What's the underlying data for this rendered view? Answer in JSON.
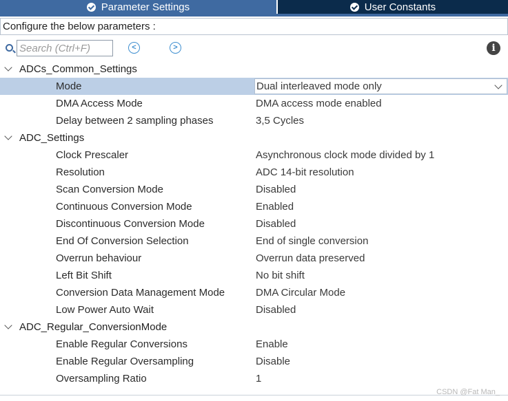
{
  "tabs": [
    {
      "label": "Parameter Settings",
      "active": true
    },
    {
      "label": "User Constants",
      "active": false
    }
  ],
  "configure_label": "Configure the below parameters :",
  "toolbar": {
    "search_placeholder": "Search (Ctrl+F)",
    "search_value": "",
    "prev_glyph": "<",
    "next_glyph": ">",
    "info_glyph": "i"
  },
  "groups": [
    {
      "name": "ADCs_Common_Settings",
      "params": [
        {
          "name": "Mode",
          "value": "Dual interleaved mode only"
        },
        {
          "name": "DMA Access Mode",
          "value": "DMA access mode enabled"
        },
        {
          "name": "Delay between 2 sampling phases",
          "value": "3,5 Cycles"
        }
      ]
    },
    {
      "name": "ADC_Settings",
      "params": [
        {
          "name": "Clock Prescaler",
          "value": "Asynchronous clock mode divided by 1"
        },
        {
          "name": "Resolution",
          "value": "ADC 14-bit resolution"
        },
        {
          "name": "Scan Conversion Mode",
          "value": "Disabled"
        },
        {
          "name": "Continuous Conversion Mode",
          "value": "Enabled"
        },
        {
          "name": "Discontinuous Conversion Mode",
          "value": "Disabled"
        },
        {
          "name": "End Of Conversion Selection",
          "value": "End of single conversion"
        },
        {
          "name": "Overrun behaviour",
          "value": "Overrun data preserved"
        },
        {
          "name": "Left Bit Shift",
          "value": "No bit shift"
        },
        {
          "name": "Conversion Data Management Mode",
          "value": "DMA Circular Mode"
        },
        {
          "name": "Low Power Auto Wait",
          "value": "Disabled"
        }
      ]
    },
    {
      "name": "ADC_Regular_ConversionMode",
      "params": [
        {
          "name": "Enable Regular Conversions",
          "value": "Enable"
        },
        {
          "name": "Enable Regular Oversampling",
          "value": "Disable"
        },
        {
          "name": "Oversampling Ratio",
          "value": "1"
        }
      ]
    }
  ],
  "watermark": "CSDN @Fat Man_",
  "colors": {
    "tab_active": "#3f6aa1",
    "tab_inactive": "#0b2b4b",
    "selected_row": "#bccfe6",
    "nav_icon": "#3f8fd0"
  }
}
